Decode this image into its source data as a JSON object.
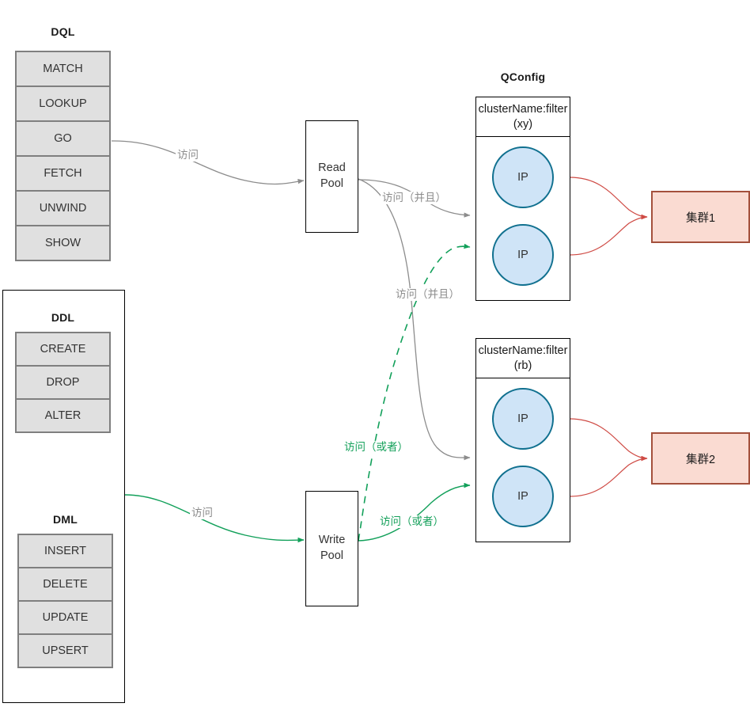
{
  "diagram": {
    "title": "Nebula Graph query routing diagram",
    "colors": {
      "read_edge": "#8c8c8c",
      "write_edge": "#12a05a",
      "cluster_edge": "#cf4b45",
      "ip_fill": "#cfe4f7",
      "ip_stroke": "#10708f",
      "cluster_fill": "#fadbd2",
      "cluster_stroke": "#a4503c",
      "stack_fill": "#e0e0e0",
      "stack_stroke": "#7f7f7f"
    }
  },
  "groups": {
    "dql": {
      "title": "DQL",
      "items": [
        "MATCH",
        "LOOKUP",
        "GO",
        "FETCH",
        "UNWIND",
        "SHOW"
      ]
    },
    "ddl": {
      "title": "DDL",
      "items": [
        "CREATE",
        "DROP",
        "ALTER"
      ]
    },
    "dml": {
      "title": "DML",
      "items": [
        "INSERT",
        "DELETE",
        "UPDATE",
        "UPSERT"
      ]
    }
  },
  "pools": {
    "read": {
      "line1": "Read",
      "line2": "Pool"
    },
    "write": {
      "line1": "Write",
      "line2": "Pool"
    }
  },
  "qconfig": {
    "title": "QConfig",
    "boxes": [
      {
        "header_line1": "clusterName:filter",
        "header_line2": "(xy)",
        "nodes": [
          {
            "label": "IP"
          },
          {
            "label": "IP"
          }
        ]
      },
      {
        "header_line1": "clusterName:filter",
        "header_line2": "(rb)",
        "nodes": [
          {
            "label": "IP"
          },
          {
            "label": "IP"
          }
        ]
      }
    ]
  },
  "clusters": [
    {
      "label": "集群1"
    },
    {
      "label": "集群2"
    }
  ],
  "edge_labels": {
    "dql_to_read": "访问",
    "read_to_qc1": "访问（并且）",
    "read_to_qc2": "访问（并且）",
    "dml_to_write": "访问",
    "write_to_qc1": "访问（或者）",
    "write_to_qc2": "访问（或者）"
  }
}
